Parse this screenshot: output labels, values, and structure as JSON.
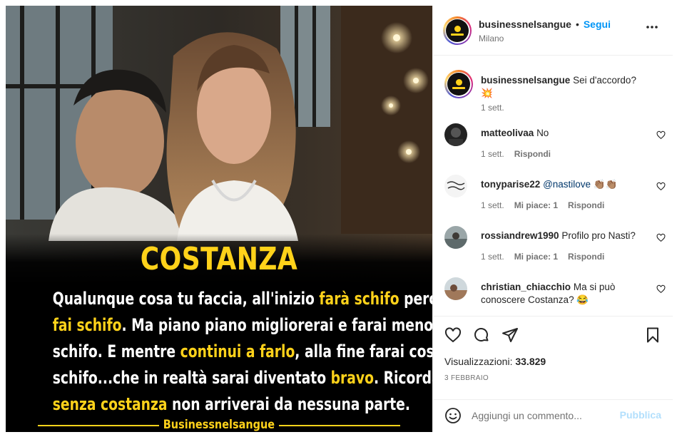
{
  "post": {
    "image_title": "COSTANZA",
    "quote_lines": [
      [
        {
          "t": "Qualunque cosa tu faccia, all'inizio ",
          "h": false
        },
        {
          "t": "farà schifo",
          "h": true
        },
        {
          "t": " perché tu",
          "h": false
        }
      ],
      [
        {
          "t": "fai schifo",
          "h": true
        },
        {
          "t": ". Ma piano piano migliorerai e farai meno",
          "h": false
        }
      ],
      [
        {
          "t": "schifo. E mentre ",
          "h": false
        },
        {
          "t": "continui a farlo",
          "h": true
        },
        {
          "t": ", alla fine farai così poco",
          "h": false
        }
      ],
      [
        {
          "t": "schifo...che in realtà sarai diventato ",
          "h": false
        },
        {
          "t": "bravo",
          "h": true
        },
        {
          "t": ". Ricorda,",
          "h": false
        }
      ],
      [
        {
          "t": "senza costanza",
          "h": true
        },
        {
          "t": " non arriverai da nessuna parte.",
          "h": false
        }
      ]
    ],
    "image_footer": "Businessnelsangue"
  },
  "header": {
    "username": "businessnelsangue",
    "separator": "•",
    "follow_label": "Segui",
    "location": "Milano"
  },
  "caption": {
    "username": "businessnelsangue",
    "text": "Sei d'accordo? 💥",
    "time": "1 sett."
  },
  "comments": [
    {
      "username": "matteolivaa",
      "text": "No",
      "mention": "",
      "time": "1 sett.",
      "likes": "",
      "reply": "Rispondi"
    },
    {
      "username": "tonyparise22",
      "text": " 👏🏽👏🏽",
      "mention": "@nastilove",
      "time": "1 sett.",
      "likes": "Mi piace: 1",
      "reply": "Rispondi"
    },
    {
      "username": "rossiandrew1990",
      "text": "Profilo pro Nasti?",
      "mention": "",
      "time": "1 sett.",
      "likes": "Mi piace: 1",
      "reply": "Rispondi"
    },
    {
      "username": "christian_chiacchio",
      "text": "Ma si può conoscere Costanza? 😂",
      "mention": "",
      "time": "",
      "likes": "",
      "reply": ""
    }
  ],
  "stats": {
    "views_label": "Visualizzazioni:",
    "views_value": "33.829",
    "date": "3 FEBBRAIO"
  },
  "composer": {
    "placeholder": "Aggiungi un commento...",
    "publish_label": "Pubblica"
  },
  "icons": {
    "like": "heart-icon",
    "comment": "comment-icon",
    "share": "share-icon",
    "save": "bookmark-icon",
    "emoji": "emoji-icon",
    "more": "more-icon"
  },
  "colors": {
    "accent_blue": "#0095f6",
    "highlight_yellow": "#ffd21a",
    "publish_disabled": "#b2dffc"
  }
}
